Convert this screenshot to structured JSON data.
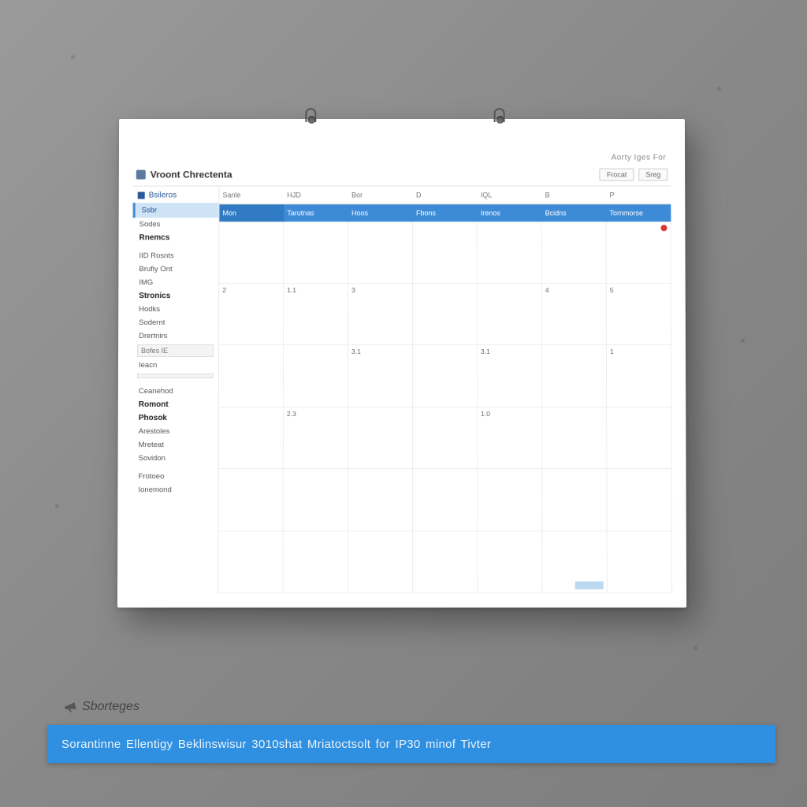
{
  "header": {
    "meta_text": "Aorty Iges For",
    "app_title": "Vroont Chrectenta",
    "buttons": {
      "primary": "Frocat",
      "secondary": "Sreg"
    }
  },
  "sidebar": {
    "checkbox_label": "Bsileros",
    "active_item": "Ssbr",
    "items": [
      "Sodes",
      "Rnemcs",
      "IID Rosnts",
      "Brufiy Ont",
      "IMG",
      "Stronics",
      "Hodks",
      "Sodernt",
      "Drertnirs"
    ],
    "boxed1": "Bofes IE",
    "after_box1": "Ieacn",
    "boxed2": "",
    "group2": [
      "Ceanehod",
      "Romont",
      "Phosok",
      "Arestoles",
      "Mreteat",
      "Sovidon"
    ],
    "footer1": "Frotoeo",
    "footer2": "Ionemond"
  },
  "grid": {
    "col_headers": [
      "Sanle",
      "HJD",
      "Bor",
      "D",
      "IQL",
      "B",
      "P"
    ],
    "blue_headers": [
      "Mon",
      "Tarutnas",
      "Hoos",
      "Fbons",
      "Irenos",
      "Bcidns",
      "Tornmorse"
    ],
    "cells": [
      [
        "",
        "",
        "",
        "",
        "",
        "",
        ""
      ],
      [
        "2",
        "1.1",
        "3",
        "",
        "",
        "4",
        "5"
      ],
      [
        "",
        "",
        "3.1",
        "",
        "3.1",
        "",
        "1"
      ],
      [
        "",
        "2.3",
        "",
        "",
        "1.0",
        "",
        ""
      ],
      [
        "",
        "",
        "",
        "",
        "",
        "",
        ""
      ],
      [
        "",
        "",
        "",
        "",
        "",
        "",
        ""
      ]
    ],
    "dot_cell": [
      0,
      6
    ]
  },
  "brand": "Sborteges",
  "banner_text": "Sorantinne Ellentigy Beklinswisur 3010shat Mriatoctsolt for IP30 minof Tivter"
}
